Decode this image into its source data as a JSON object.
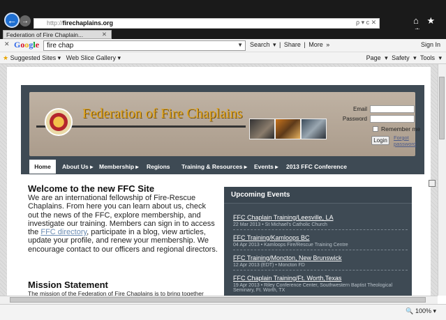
{
  "browser": {
    "url_prefix": "http://",
    "url_domain": "firechaplains.org",
    "tab_title": "Federation of Fire Chaplain...",
    "url_controls": "ρ ▾ c ✕",
    "top_icons": "⌂ ★ ⚙"
  },
  "google_bar": {
    "search_value": "fire chap",
    "search_label": "Search ▾",
    "share_label": "Share",
    "more_label": "More »",
    "sign_in": "Sign In"
  },
  "favorites_bar": {
    "suggested": "Suggested Sites ▾",
    "web_slice": "Web Slice Gallery ▾",
    "tools_right": "Page ▾  Safety ▾  Tools ▾"
  },
  "status": {
    "zoom": "100%"
  },
  "site": {
    "title": "Federation of Fire Chaplains",
    "email_label": "Email",
    "password_label": "Password",
    "remember_label": "Remember me",
    "login_button": "Login",
    "forgot_password": "Forgot password",
    "nav": [
      "Home",
      "About Us ▸",
      "Membership ▸",
      "Regions",
      "Training & Resources ▸",
      "Events ▸",
      "2013 FFC Conference"
    ],
    "welcome_heading": "Welcome to the new FFC Site",
    "intro_part1": "We are an international fellowship of Fire-Rescue Chaplains. From here you can learn about us, check out the news of the FFC, explore membership, and investigate our training. Members can sign in to access the ",
    "intro_link": "FFC directory",
    "intro_part2": ", participate in a blog, view articles, update your profile, and renew your membership. We encourage contact to our officers and regional directors.",
    "mission_heading": "Mission Statement",
    "mission_text": "The mission of the Federation of Fire Chaplains is to bring together persons interested in providing an effective Chaplain Service; to",
    "events_heading": "Upcoming Events",
    "events": [
      {
        "title": "FFC Chaplain Training/Leesville, LA",
        "detail": "22 Mar 2013 • St Michael's Catholic Church"
      },
      {
        "title": "FFC Training/Kamloops BC",
        "detail": "04 Apr 2013 • Kamloops Fire/Rescue Training Centre"
      },
      {
        "title": "FFC Training/Moncton, New Brunswick",
        "detail": "12 Apr 2013 (EDT) • Moncton FD"
      },
      {
        "title": "FFC Chaplain Training/Ft. Worth,Texas",
        "detail": "19 Apr 2013 • Riley Conference Center, Southwestern Baptist Theological Seminary, Ft. Worth, TX"
      }
    ]
  }
}
